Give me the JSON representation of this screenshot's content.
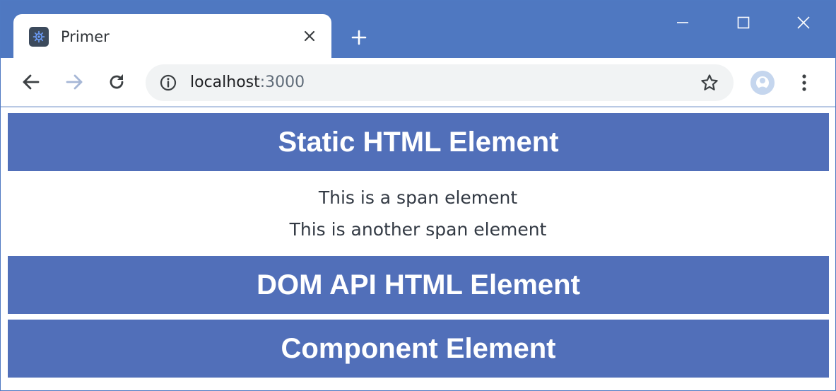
{
  "browser": {
    "tab": {
      "title": "Primer",
      "favicon": "app-gear-icon",
      "close_icon": "close-icon"
    },
    "new_tab_icon": "plus-icon",
    "window_controls": [
      "minimize-icon",
      "maximize-icon",
      "close-icon"
    ],
    "toolbar": {
      "back_icon": "arrow-left-icon",
      "forward_icon": "arrow-right-icon",
      "reload_icon": "reload-icon",
      "address": {
        "host": "localhost",
        "port": ":3000",
        "info_icon": "info-icon",
        "bookmark_icon": "star-icon"
      },
      "profile_icon": "avatar",
      "menu_icon": "kebab-menu-icon"
    }
  },
  "page": {
    "static_heading": "Static HTML Element",
    "span_1": "This is a span element",
    "span_2": "This is another span element",
    "dom_heading": "DOM API HTML Element",
    "component_heading": "Component Element"
  },
  "colors": {
    "titlebar": "#4f78c1",
    "banner": "#516fb9",
    "omnibox": "#f1f3f4",
    "text": "#333a44"
  }
}
